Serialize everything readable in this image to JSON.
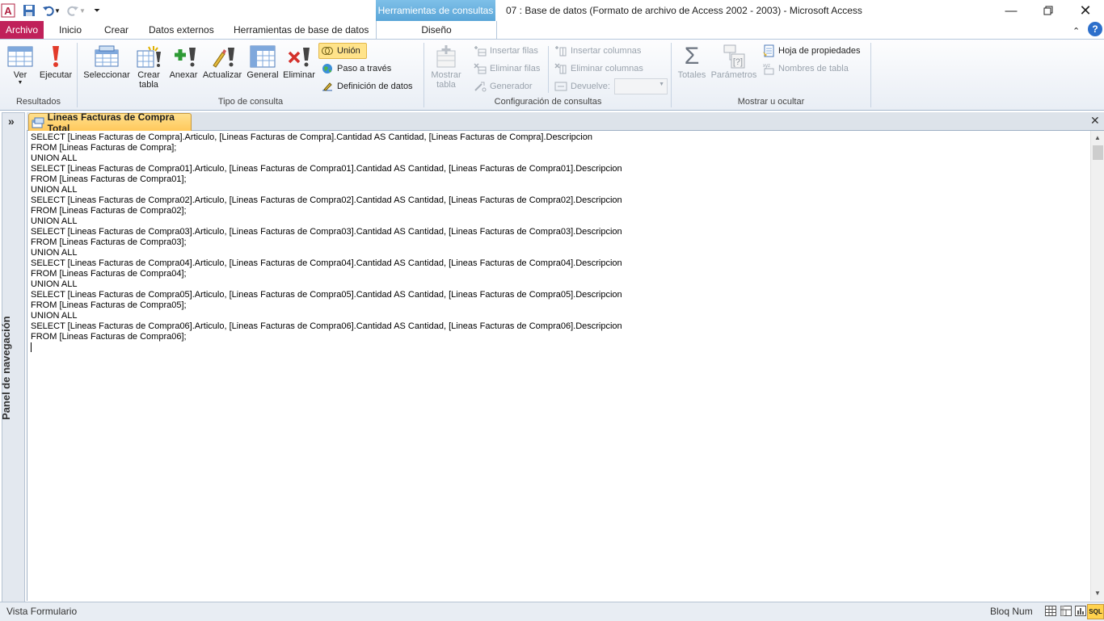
{
  "titlebar": {
    "context_group": "Herramientas de consultas",
    "window_title": "07 : Base de datos (Formato de archivo de Access 2002 - 2003)  -  Microsoft Access"
  },
  "tabs": {
    "archivo": "Archivo",
    "inicio": "Inicio",
    "crear": "Crear",
    "datos_externos": "Datos externos",
    "herramientas_bd": "Herramientas de base de datos",
    "diseno": "Diseño"
  },
  "ribbon": {
    "resultados": {
      "label": "Resultados",
      "ver": "Ver",
      "ejecutar": "Ejecutar"
    },
    "tipo_consulta": {
      "label": "Tipo de consulta",
      "seleccionar": "Seleccionar",
      "crear_tabla_1": "Crear",
      "crear_tabla_2": "tabla",
      "anexar": "Anexar",
      "actualizar": "Actualizar",
      "general": "General",
      "eliminar": "Eliminar",
      "union": "Unión",
      "paso_a_traves": "Paso a través",
      "definicion_datos": "Definición de datos"
    },
    "configuracion": {
      "label": "Configuración de consultas",
      "mostrar_tabla_1": "Mostrar",
      "mostrar_tabla_2": "tabla",
      "insertar_filas": "Insertar filas",
      "eliminar_filas": "Eliminar filas",
      "generador": "Generador",
      "insertar_columnas": "Insertar columnas",
      "eliminar_columnas": "Eliminar columnas",
      "devuelve": "Devuelve:"
    },
    "mostrar_ocultar": {
      "label": "Mostrar u ocultar",
      "totales": "Totales",
      "parametros": "Parámetros",
      "hoja_propiedades": "Hoja de propiedades",
      "nombres_tabla": "Nombres de tabla"
    }
  },
  "navpane": {
    "label": "Panel de navegación",
    "expand": "»"
  },
  "document": {
    "tab_title": "Lineas Facturas de Compra Total",
    "sql": "SELECT [Lineas Facturas de Compra].Articulo, [Lineas Facturas de Compra].Cantidad AS Cantidad, [Lineas Facturas de Compra].Descripcion\nFROM [Lineas Facturas de Compra];\nUNION ALL\nSELECT [Lineas Facturas de Compra01].Articulo, [Lineas Facturas de Compra01].Cantidad AS Cantidad, [Lineas Facturas de Compra01].Descripcion\nFROM [Lineas Facturas de Compra01];\nUNION ALL\nSELECT [Lineas Facturas de Compra02].Articulo, [Lineas Facturas de Compra02].Cantidad AS Cantidad, [Lineas Facturas de Compra02].Descripcion\nFROM [Lineas Facturas de Compra02];\nUNION ALL\nSELECT [Lineas Facturas de Compra03].Articulo, [Lineas Facturas de Compra03].Cantidad AS Cantidad, [Lineas Facturas de Compra03].Descripcion\nFROM [Lineas Facturas de Compra03];\nUNION ALL\nSELECT [Lineas Facturas de Compra04].Articulo, [Lineas Facturas de Compra04].Cantidad AS Cantidad, [Lineas Facturas de Compra04].Descripcion\nFROM [Lineas Facturas de Compra04];\nUNION ALL\nSELECT [Lineas Facturas de Compra05].Articulo, [Lineas Facturas de Compra05].Cantidad AS Cantidad, [Lineas Facturas de Compra05].Descripcion\nFROM [Lineas Facturas de Compra05];\nUNION ALL\nSELECT [Lineas Facturas de Compra06].Articulo, [Lineas Facturas de Compra06].Cantidad AS Cantidad, [Lineas Facturas de Compra06].Descripcion\nFROM [Lineas Facturas de Compra06];"
  },
  "statusbar": {
    "left": "Vista Formulario",
    "right": "Bloq Num",
    "sql_badge": "SQL"
  },
  "colors": {
    "archivo_tab": "#c0215a",
    "context_tab": "#5aa6d8",
    "doc_tab": "#ffc85b"
  }
}
